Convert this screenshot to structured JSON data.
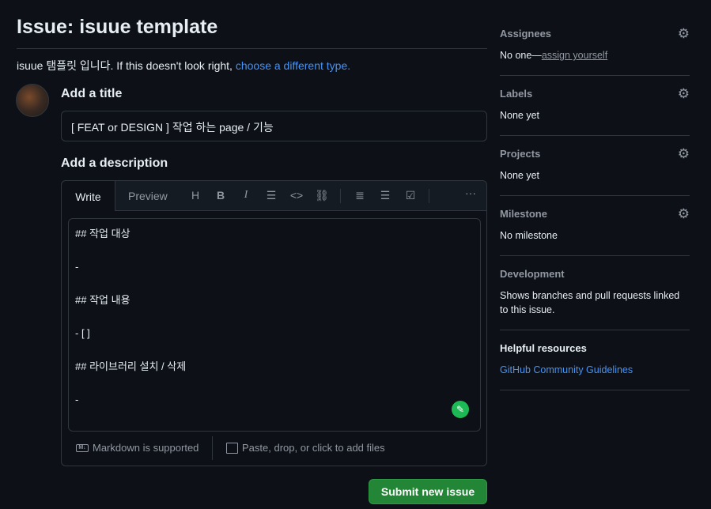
{
  "page": {
    "title": "Issue: isuue template",
    "subtitle_text": "isuue 탬플릿 입니다. If this doesn't look right, ",
    "subtitle_link": "choose a different type."
  },
  "form": {
    "title_label": "Add a title",
    "title_value": "[ FEAT or DESIGN ] 작업 하는 page / 기능",
    "description_label": "Add a description",
    "tabs": {
      "write": "Write",
      "preview": "Preview"
    },
    "toolbar_icons": [
      "heading-icon",
      "bold-icon",
      "italic-icon",
      "quote-icon",
      "code-icon",
      "link-icon",
      "numbered-list-icon",
      "unordered-list-icon",
      "task-list-icon",
      "more-icon"
    ],
    "description_value": "## 작업 대상\n\n-\n\n## 작업 내용\n\n- [ ]\n\n## 라이브러리 설치 / 삭제\n\n-",
    "markdown_note": "Markdown is supported",
    "attach_note": "Paste, drop, or click to add files",
    "submit": "Submit new issue"
  },
  "sidebar": {
    "assignees": {
      "title": "Assignees",
      "value": "No one—",
      "link": "assign yourself"
    },
    "labels": {
      "title": "Labels",
      "value": "None yet"
    },
    "projects": {
      "title": "Projects",
      "value": "None yet"
    },
    "milestone": {
      "title": "Milestone",
      "value": "No milestone"
    },
    "development": {
      "title": "Development",
      "value": "Shows branches and pull requests linked to this issue."
    },
    "helpful": {
      "title": "Helpful resources",
      "link": "GitHub Community Guidelines"
    }
  },
  "colors": {
    "background": "#0d1117",
    "link": "#4493f8",
    "primary_button": "#238636"
  }
}
